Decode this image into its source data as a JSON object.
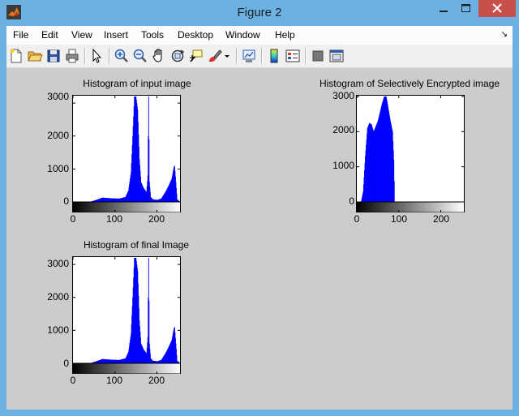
{
  "window": {
    "title": "Figure 2"
  },
  "menu": [
    "File",
    "Edit",
    "View",
    "Insert",
    "Tools",
    "Desktop",
    "Window",
    "Help"
  ],
  "toolbar": {
    "icons": [
      "new-figure-icon",
      "open-file-icon",
      "save-icon",
      "print-icon",
      "pointer-icon",
      "zoom-in-icon",
      "zoom-out-icon",
      "pan-hand-icon",
      "rotate-3d-icon",
      "data-cursor-icon",
      "brush-icon",
      "brush-dropdown-icon",
      "link-plot-icon",
      "colorbar-icon",
      "legend-icon",
      "hide-plot-tools-icon",
      "show-plot-tools-icon"
    ]
  },
  "colors": {
    "bar": "#0000ff",
    "figure_bg": "#cccccc",
    "close": "#c7504b"
  },
  "chart_data": [
    {
      "type": "bar",
      "title": "Histogram of input image",
      "xlim": [
        0,
        255
      ],
      "ylim": [
        0,
        3200
      ],
      "xticks": [
        "0",
        "100",
        "200"
      ],
      "yticks": [
        "0",
        "1000",
        "2000",
        "3000"
      ],
      "series": [
        {
          "x": [
            0,
            40,
            55,
            70,
            90,
            110,
            125,
            132,
            138,
            142,
            146,
            150,
            154,
            158,
            162,
            168,
            175,
            178,
            180,
            182,
            185,
            190,
            200,
            210,
            220,
            228,
            235,
            240,
            242,
            245,
            248,
            255
          ],
          "values": [
            0,
            0,
            60,
            130,
            110,
            100,
            150,
            350,
            900,
            2000,
            3200,
            3200,
            2800,
            1300,
            600,
            420,
            300,
            800,
            3200,
            600,
            150,
            80,
            60,
            100,
            300,
            500,
            700,
            1050,
            1100,
            600,
            80,
            0
          ]
        }
      ]
    },
    {
      "type": "bar",
      "title": "Histogram of Selectively Encrypted image",
      "xlim": [
        0,
        255
      ],
      "ylim": [
        0,
        3000
      ],
      "xticks": [
        "0",
        "100",
        "200"
      ],
      "yticks": [
        "0",
        "1000",
        "2000",
        "3000"
      ],
      "series": [
        {
          "x": [
            0,
            10,
            15,
            20,
            25,
            30,
            35,
            40,
            45,
            50,
            55,
            60,
            65,
            70,
            75,
            80,
            85,
            88,
            90,
            95,
            255
          ],
          "values": [
            0,
            0,
            300,
            1300,
            2100,
            2250,
            2200,
            2000,
            2150,
            2300,
            2550,
            2800,
            3000,
            3000,
            2650,
            2300,
            2000,
            1200,
            0,
            0,
            0
          ]
        }
      ]
    },
    {
      "type": "bar",
      "title": "Histogram of final Image",
      "xlim": [
        0,
        255
      ],
      "ylim": [
        0,
        3200
      ],
      "xticks": [
        "0",
        "100",
        "200"
      ],
      "yticks": [
        "0",
        "1000",
        "2000",
        "3000"
      ],
      "series": [
        {
          "x": [
            0,
            40,
            55,
            70,
            90,
            110,
            125,
            132,
            138,
            142,
            146,
            150,
            154,
            158,
            162,
            168,
            175,
            178,
            180,
            182,
            185,
            190,
            200,
            210,
            220,
            228,
            235,
            240,
            242,
            245,
            248,
            255
          ],
          "values": [
            0,
            0,
            60,
            130,
            110,
            100,
            150,
            350,
            900,
            2000,
            3200,
            3200,
            2800,
            1300,
            600,
            420,
            300,
            800,
            3200,
            600,
            150,
            80,
            60,
            100,
            300,
            500,
            700,
            1050,
            1100,
            600,
            80,
            0
          ]
        }
      ]
    }
  ]
}
